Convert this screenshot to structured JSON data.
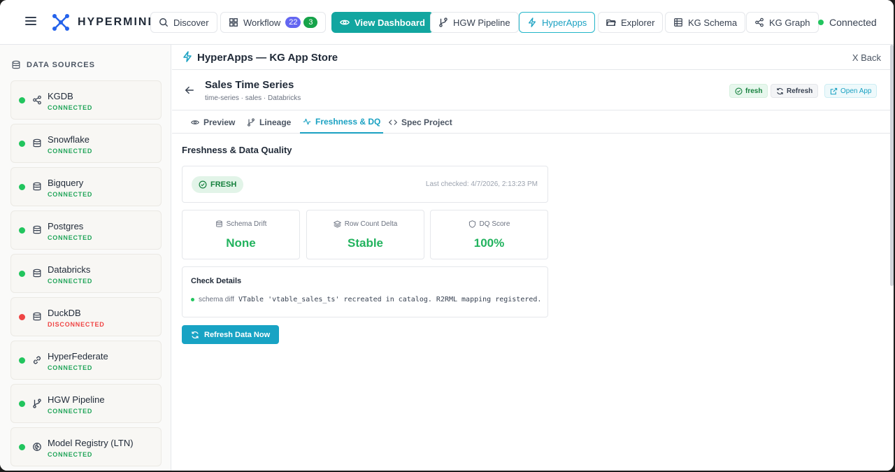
{
  "app": {
    "brand": "HYPERMIND"
  },
  "nav": {
    "discover": "Discover",
    "workflow": "Workflow",
    "workflow_badge_1": "22",
    "workflow_badge_2": "3",
    "view_dashboard": "View Dashboard",
    "hgw_pipeline": "HGW Pipeline",
    "hyperapps": "HyperApps",
    "explorer": "Explorer",
    "kg_schema": "KG Schema",
    "kg_graph": "KG Graph",
    "connection_status": "Connected"
  },
  "sidebar": {
    "title": "DATA SOURCES",
    "items": [
      {
        "name": "KGDB",
        "status": "CONNECTED",
        "icon": "share-icon",
        "state": "ok"
      },
      {
        "name": "Snowflake",
        "status": "CONNECTED",
        "icon": "database-icon",
        "state": "ok"
      },
      {
        "name": "Bigquery",
        "status": "CONNECTED",
        "icon": "database-icon",
        "state": "ok"
      },
      {
        "name": "Postgres",
        "status": "CONNECTED",
        "icon": "database-icon",
        "state": "ok"
      },
      {
        "name": "Databricks",
        "status": "CONNECTED",
        "icon": "database-icon",
        "state": "ok"
      },
      {
        "name": "DuckDB",
        "status": "DISCONNECTED",
        "icon": "database-icon",
        "state": "error"
      },
      {
        "name": "HyperFederate",
        "status": "CONNECTED",
        "icon": "link-icon",
        "state": "ok"
      },
      {
        "name": "HGW Pipeline",
        "status": "CONNECTED",
        "icon": "git-branch-icon",
        "state": "ok"
      },
      {
        "name": "Model Registry (LTN)",
        "status": "CONNECTED",
        "icon": "brain-icon",
        "state": "ok"
      }
    ]
  },
  "main": {
    "header_title": "HyperApps — KG App Store",
    "back_label": "X Back",
    "app_title": "Sales Time Series",
    "app_subtitle": "time-series · sales · Databricks",
    "fresh_pill": "fresh",
    "refresh_label": "Refresh",
    "open_app_label": "Open App",
    "tabs": [
      "Preview",
      "Lineage",
      "Freshness & DQ",
      "Spec Project"
    ],
    "active_tab": "Freshness & DQ",
    "section_title": "Freshness & Data Quality",
    "status_badge": "FRESH",
    "last_checked": "Last checked: 4/7/2026, 2:13:23 PM",
    "metrics": [
      {
        "label": "Schema Drift",
        "value": "None"
      },
      {
        "label": "Row Count Delta",
        "value": "Stable"
      },
      {
        "label": "DQ Score",
        "value": "100%"
      }
    ],
    "check_details_title": "Check Details",
    "check_kind": "schema diff",
    "check_message": "VTable 'vtable_sales_ts' recreated in catalog. R2RML mapping registered.",
    "refresh_now_label": "Refresh Data Now"
  },
  "colors": {
    "accent": "#1aa1c2",
    "primary_button": "#12a6a0",
    "success": "#22c55e",
    "error": "#ef4444"
  }
}
